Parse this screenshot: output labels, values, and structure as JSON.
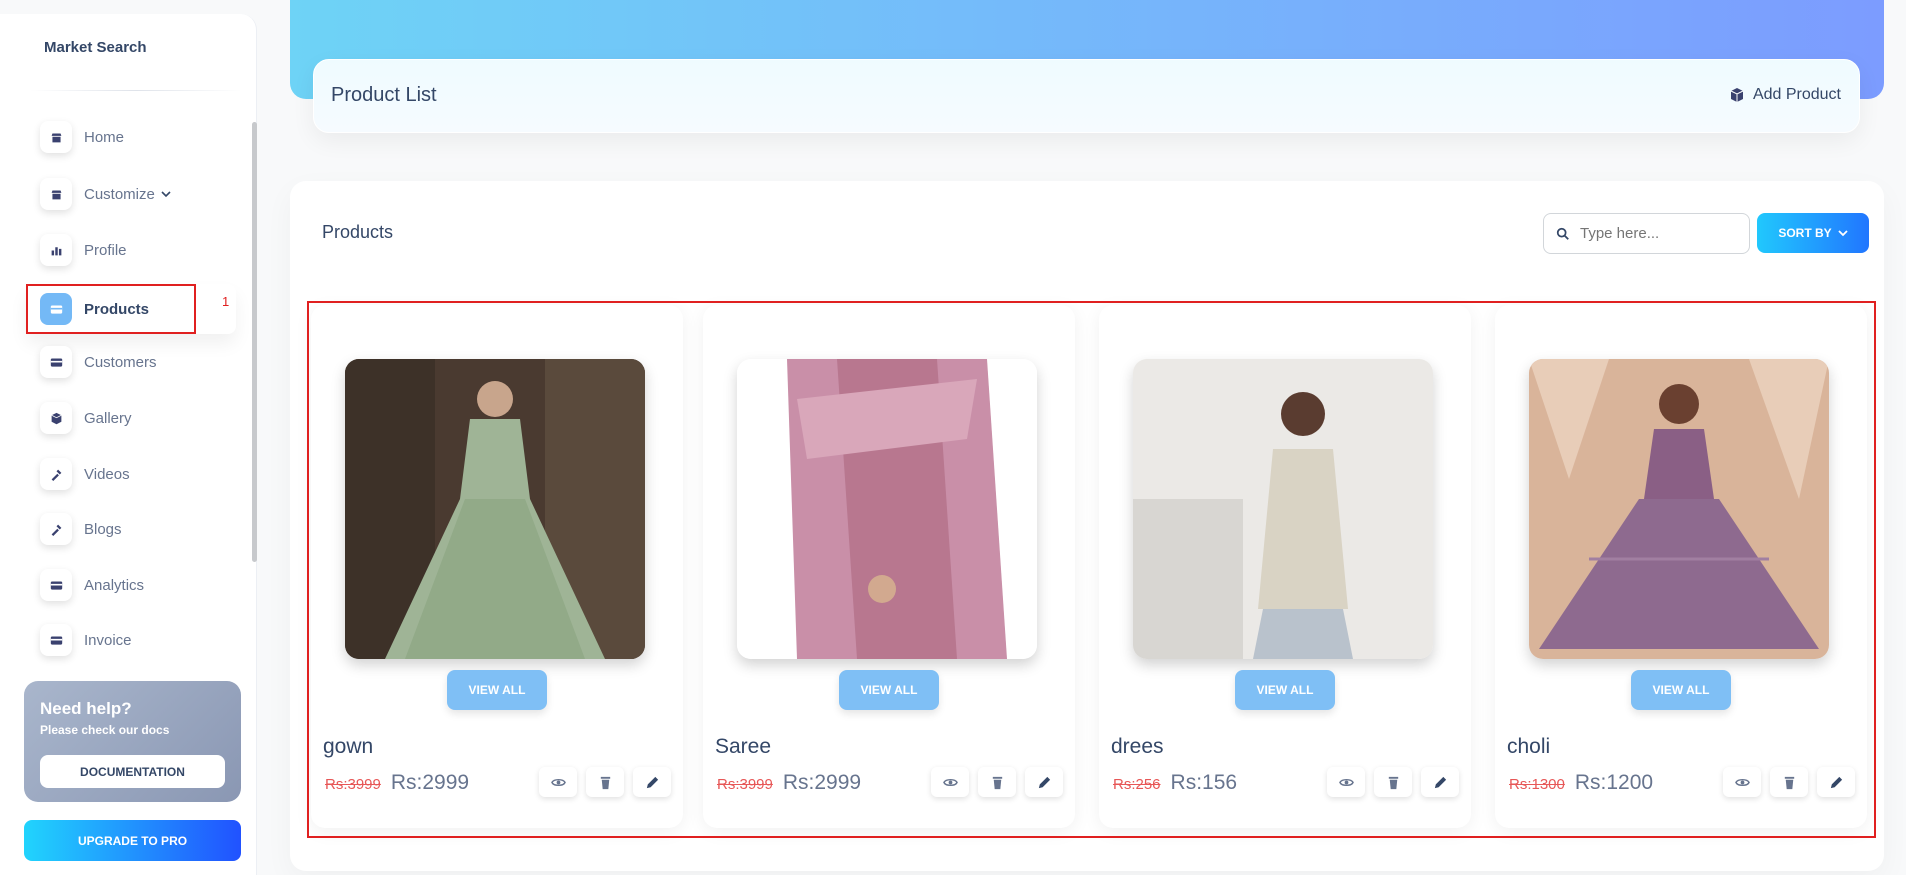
{
  "sidebar": {
    "brand": "Market Search",
    "items": [
      {
        "label": "Home",
        "icon": "store-icon"
      },
      {
        "label": "Customize",
        "icon": "store-icon"
      },
      {
        "label": "Profile",
        "icon": "chart-bar-icon"
      },
      {
        "label": "Products",
        "icon": "credit-card-icon",
        "active": true
      },
      {
        "label": "Customers",
        "icon": "credit-card-icon"
      },
      {
        "label": "Gallery",
        "icon": "box-icon"
      },
      {
        "label": "Videos",
        "icon": "tools-icon"
      },
      {
        "label": "Blogs",
        "icon": "tools-icon"
      },
      {
        "label": "Analytics",
        "icon": "credit-card-icon"
      },
      {
        "label": "Invoice",
        "icon": "credit-card-icon"
      }
    ],
    "annotation_number": "1",
    "help": {
      "title": "Need help?",
      "subtitle": "Please check our docs",
      "button": "DOCUMENTATION"
    },
    "upgrade": "UPGRADE TO PRO"
  },
  "header": {
    "title": "Product List",
    "add_product": "Add Product"
  },
  "main": {
    "title": "Products",
    "search_placeholder": "Type here...",
    "sort_label": "SORT BY",
    "view_all_label": "VIEW ALL",
    "products": [
      {
        "name": "gown",
        "old_price": "Rs:3999",
        "new_price": "Rs:2999"
      },
      {
        "name": "Saree",
        "old_price": "Rs:3999",
        "new_price": "Rs:2999"
      },
      {
        "name": "drees",
        "old_price": "Rs:256",
        "new_price": "Rs:156"
      },
      {
        "name": "choli",
        "old_price": "Rs:1300",
        "new_price": "Rs:1200"
      }
    ]
  },
  "colors": {
    "accent": "#2152ff",
    "highlight": "#e02020",
    "active_icon_bg": "#74b9f6"
  }
}
